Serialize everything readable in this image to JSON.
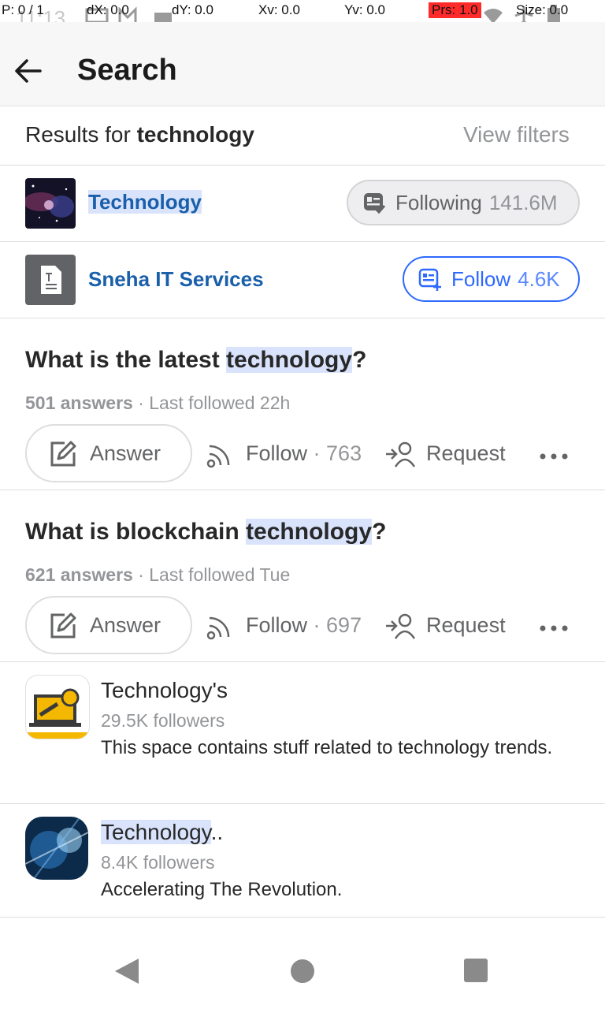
{
  "status_bar": {
    "time": "11:13"
  },
  "debug_overlay": {
    "p": "P: 0 / 1",
    "dx": "dX: 0.0",
    "dy": "dY: 0.0",
    "xv": "Xv: 0.0",
    "yv": "Yv: 0.0",
    "prs": "Prs: 1.0",
    "size": "Size: 0.0"
  },
  "header": {
    "title": "Search"
  },
  "results": {
    "prefix": "Results for ",
    "query": "technology",
    "view_filters": "View filters"
  },
  "topics": [
    {
      "name": "Technology",
      "button_label": "Following",
      "count": "141.6M"
    },
    {
      "name": "Sneha IT Services",
      "button_label": "Follow",
      "count": "4.6K"
    }
  ],
  "questions": [
    {
      "title_prefix": "What is the latest ",
      "title_highlight": "technology",
      "title_suffix": "?",
      "answers": "501 answers",
      "last": " · Last followed 22h",
      "answer_label": "Answer",
      "follow_label": "Follow",
      "follow_count": "· 763",
      "request_label": "Request"
    },
    {
      "title_prefix": "What is blockchain ",
      "title_highlight": "technology",
      "title_suffix": "?",
      "answers": "621 answers",
      "last": " · Last followed Tue",
      "answer_label": "Answer",
      "follow_label": "Follow",
      "follow_count": "· 697",
      "request_label": "Request"
    }
  ],
  "spaces": [
    {
      "name": "Technology's",
      "followers": "29.5K followers",
      "description": "This space contains stuff related to technology trends."
    },
    {
      "name_highlight": "Technology",
      "name_suffix": "..",
      "followers": "8.4K followers",
      "description": "Accelerating The Revolution."
    }
  ],
  "colors": {
    "link_blue": "#195faa",
    "follow_blue": "#2e69ff",
    "highlight": "#d9e3fb",
    "gray_text": "#939598"
  }
}
